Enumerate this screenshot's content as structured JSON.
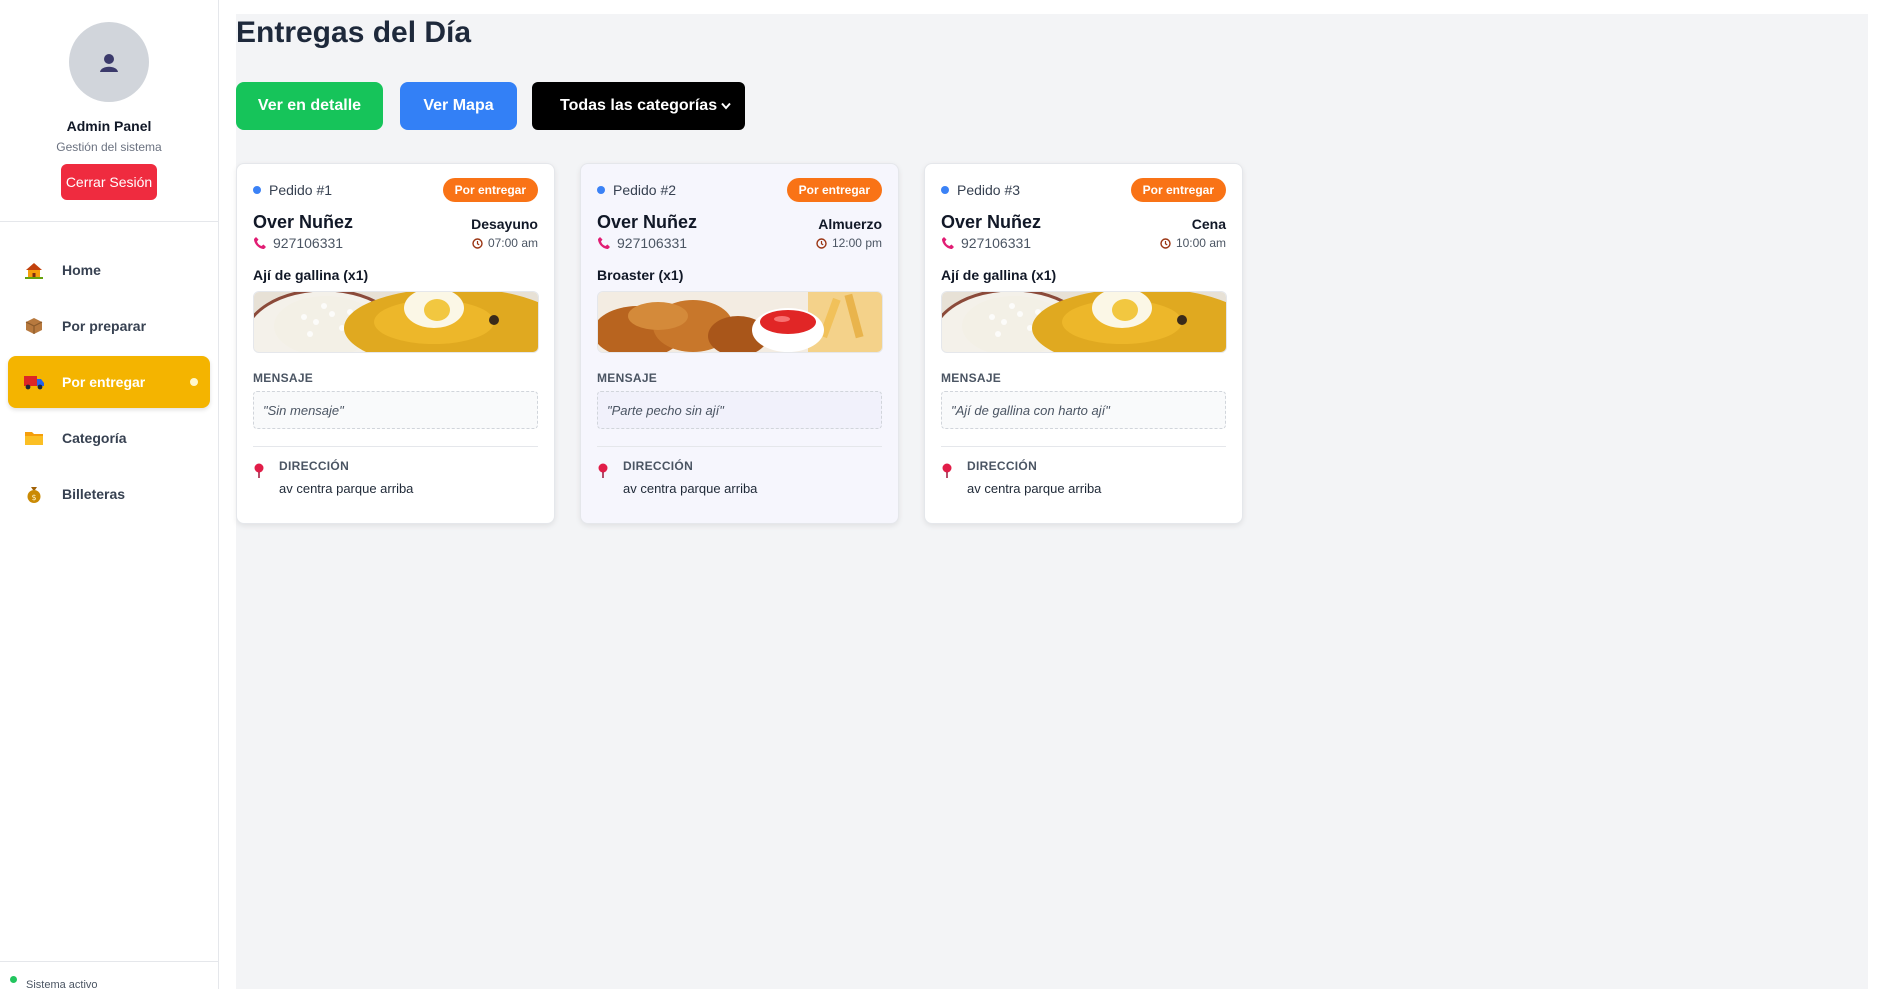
{
  "sidebar": {
    "admin_name": "Admin Panel",
    "admin_subtitle": "Gestión del sistema",
    "logout_label": "Cerrar Sesión",
    "items": [
      {
        "label": "Home",
        "icon": "house-icon"
      },
      {
        "label": "Por preparar",
        "icon": "package-icon"
      },
      {
        "label": "Por entregar",
        "icon": "delivery-truck-icon",
        "active": true
      },
      {
        "label": "Categoría",
        "icon": "folder-icon"
      },
      {
        "label": "Billeteras",
        "icon": "money-bag-icon"
      }
    ],
    "footer_status": "Sistema activo"
  },
  "main": {
    "title": "Entregas del Día",
    "buttons": {
      "detail": "Ver en detalle",
      "map": "Ver Mapa"
    },
    "category_select": {
      "selected": "Todas las categorías"
    },
    "message_label": "MENSAJE",
    "address_label": "DIRECCIÓN",
    "orders": [
      {
        "id": "Pedido #1",
        "status": "Por entregar",
        "client": "Over Nuñez",
        "phone": "927106331",
        "meal": "Desayuno",
        "time": "07:00 am",
        "product": "Ají de gallina (x1)",
        "image": "aji-de-gallina-image",
        "message": "\"Sin mensaje\"",
        "address": "av centra parque arriba"
      },
      {
        "id": "Pedido #2",
        "status": "Por entregar",
        "client": "Over Nuñez",
        "phone": "927106331",
        "meal": "Almuerzo",
        "time": "12:00 pm",
        "product": "Broaster (x1)",
        "image": "broaster-image",
        "message": "\"Parte pecho sin ají\"",
        "address": "av centra parque arriba"
      },
      {
        "id": "Pedido #3",
        "status": "Por entregar",
        "client": "Over Nuñez",
        "phone": "927106331",
        "meal": "Cena",
        "time": "10:00 am",
        "product": "Ají de gallina (x1)",
        "image": "aji-de-gallina-image",
        "message": "\"Ají de gallina con harto ají\"",
        "address": "av centra parque arriba"
      }
    ]
  },
  "colors": {
    "active_nav": "#f4b400",
    "detail_button": "#16c45a",
    "map_button": "#3380f6",
    "status_badge": "#f97316",
    "logout_button": "#ef2b3f"
  }
}
